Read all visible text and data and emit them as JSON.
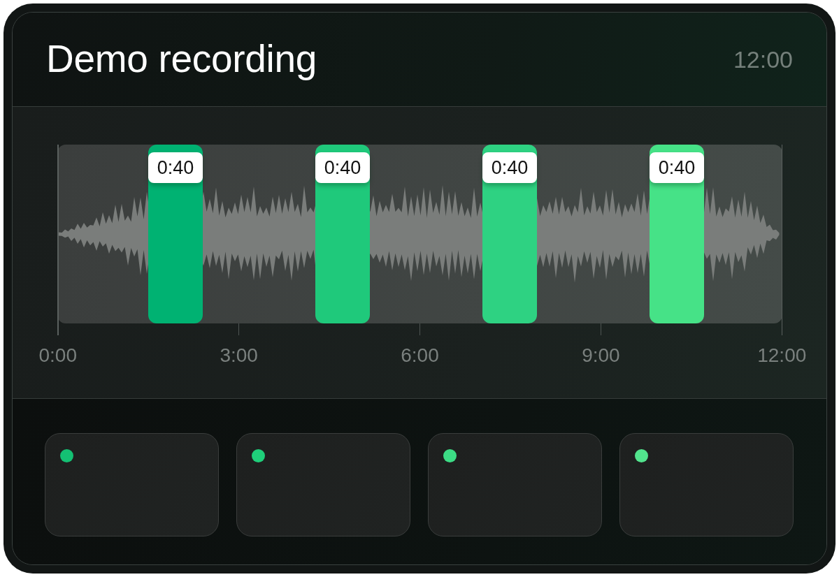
{
  "header": {
    "title": "Demo recording",
    "duration": "12:00"
  },
  "timeline": {
    "segments": [
      {
        "label": "0:40",
        "color": "#00b272"
      },
      {
        "label": "0:40",
        "color": "#1fc97b"
      },
      {
        "label": "0:40",
        "color": "#2ed282"
      },
      {
        "label": "0:40",
        "color": "#46e287"
      }
    ],
    "ticks": [
      "0:00",
      "3:00",
      "6:00",
      "9:00",
      "12:00"
    ]
  },
  "cards": [
    {
      "color": "#14c073"
    },
    {
      "color": "#1fcf7a"
    },
    {
      "color": "#3cdc85"
    },
    {
      "color": "#52e48d"
    }
  ]
}
